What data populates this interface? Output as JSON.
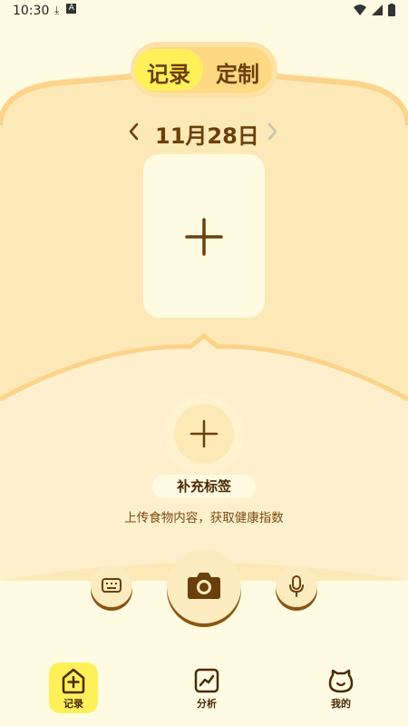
{
  "status_bar": {
    "time": "10:30",
    "left_icons": [
      "download-icon",
      "text-a-icon"
    ],
    "right_icons": [
      "wifi-icon",
      "signal-icon",
      "battery-icon"
    ]
  },
  "segment": {
    "options": [
      "记录",
      "定制"
    ],
    "selected": "记录"
  },
  "date_nav": {
    "prev_icon": "chevron-left-icon",
    "date": "11月28日",
    "next_icon": "chevron-right-icon"
  },
  "add_image_icon": "plus-icon",
  "add_tag": {
    "icon": "plus-icon",
    "label": "补充标签",
    "hint": "上传食物内容，获取健康指数"
  },
  "actions": {
    "keyboard_icon": "keyboard-icon",
    "camera_icon": "camera-icon",
    "mic_icon": "microphone-icon"
  },
  "bottom_nav": {
    "items": [
      {
        "label": "记录",
        "icon": "add-record-icon",
        "active": true
      },
      {
        "label": "分析",
        "icon": "chart-icon",
        "active": false
      },
      {
        "label": "我的",
        "icon": "bear-face-icon",
        "active": false
      }
    ]
  },
  "colors": {
    "background": "#fffbe3",
    "panel": "#fdebbd",
    "accent": "#fff05a",
    "brown": "#6b3f0a"
  }
}
